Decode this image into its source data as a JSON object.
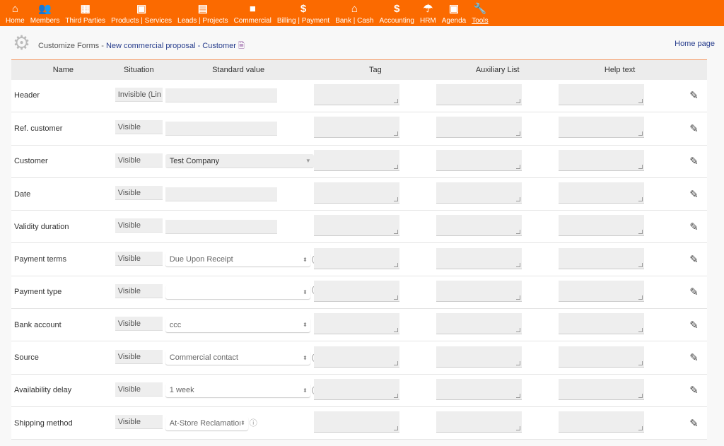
{
  "nav": [
    {
      "label": "Home",
      "icon": "home-icon",
      "glyph": "⌂"
    },
    {
      "label": "Members",
      "icon": "members-icon",
      "glyph": "👥"
    },
    {
      "label": "Third Parties",
      "icon": "building-icon",
      "glyph": "▦"
    },
    {
      "label": "Products | Services",
      "icon": "image-icon",
      "glyph": "▣"
    },
    {
      "label": "Leads | Projects",
      "icon": "clipboard-icon",
      "glyph": "▤"
    },
    {
      "label": "Commercial",
      "icon": "briefcase-icon",
      "glyph": "■"
    },
    {
      "label": "Billing | Payment",
      "icon": "dollar-icon",
      "glyph": "$"
    },
    {
      "label": "Bank | Cash",
      "icon": "bank-icon",
      "glyph": "⌂"
    },
    {
      "label": "Accounting",
      "icon": "dollar-icon",
      "glyph": "$"
    },
    {
      "label": "HRM",
      "icon": "umbrella-icon",
      "glyph": "☂"
    },
    {
      "label": "Agenda",
      "icon": "calendar-icon",
      "glyph": "▣"
    },
    {
      "label": "Tools",
      "icon": "wrench-icon",
      "glyph": "🔧",
      "active": true
    }
  ],
  "title": {
    "prefix": "Customize Forms",
    "sep": " - ",
    "link": "New commercial proposal - Customer",
    "home": "Home page"
  },
  "columns": [
    "Name",
    "Situation",
    "Standard value",
    "Tag",
    "Auxiliary List",
    "Help text"
  ],
  "rows": [
    {
      "name": "Header",
      "situation": "Invisible (Lin",
      "type": "input",
      "value": ""
    },
    {
      "name": "Ref. customer",
      "situation": "Visible",
      "type": "input",
      "value": ""
    },
    {
      "name": "Customer",
      "situation": "Visible",
      "type": "combo",
      "value": "Test Company"
    },
    {
      "name": "Date",
      "situation": "Visible",
      "type": "input",
      "value": ""
    },
    {
      "name": "Validity duration",
      "situation": "Visible",
      "type": "input",
      "value": ""
    },
    {
      "name": "Payment terms",
      "situation": "Visible",
      "type": "select",
      "value": "Due Upon Receipt",
      "extra": "("
    },
    {
      "name": "Payment type",
      "situation": "Visible",
      "type": "select",
      "value": "",
      "extra": "("
    },
    {
      "name": "Bank account",
      "situation": "Visible",
      "type": "select",
      "value": "ccc"
    },
    {
      "name": "Source",
      "situation": "Visible",
      "type": "select",
      "value": "Commercial contact",
      "extra": "("
    },
    {
      "name": "Availability delay",
      "situation": "Visible",
      "type": "select",
      "value": "1 week",
      "extra": "("
    },
    {
      "name": "Shipping method",
      "situation": "Visible",
      "type": "select-short",
      "value": "At-Store Reclamation",
      "extra": "ⓘ"
    }
  ]
}
